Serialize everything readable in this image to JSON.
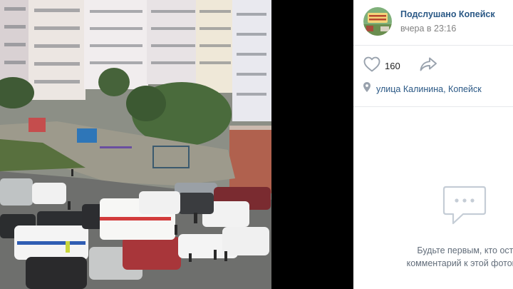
{
  "post": {
    "author": "Подслушано Копейск",
    "time": "вчера в 23:16",
    "avatar_text": "ПОДСЛУШАНО КОПЕЙСК"
  },
  "actions": {
    "likes": "160"
  },
  "location": {
    "text": "улица Калинина, Копейск"
  },
  "comments": {
    "empty_line1": "Будьте первым, кто оставит",
    "empty_line2": "комментарий к этой фотографии"
  },
  "colors": {
    "link": "#2a5885",
    "muted": "#828282",
    "icon": "#99a2ad"
  },
  "icons": [
    "heart-icon",
    "share-icon",
    "location-pin-icon",
    "comment-bubble-icon"
  ]
}
